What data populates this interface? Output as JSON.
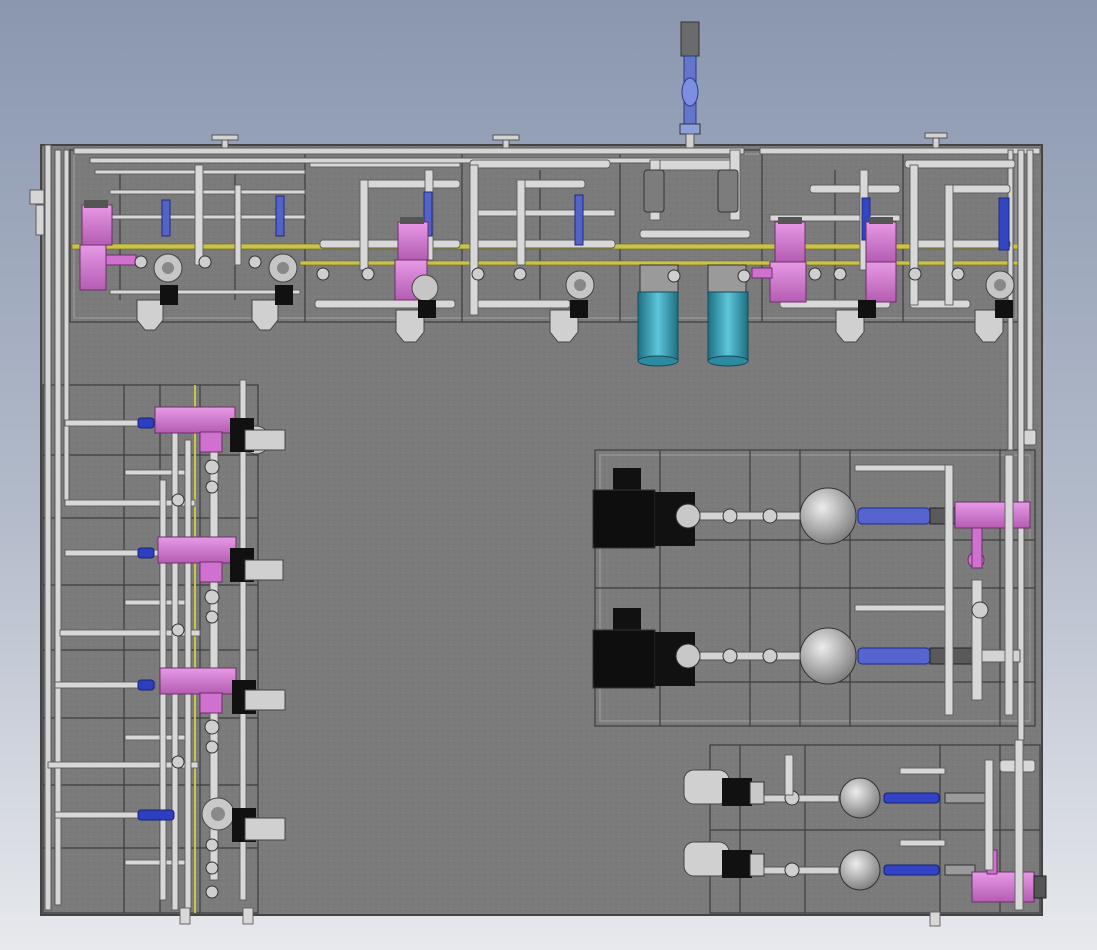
{
  "view": {
    "background_top": "#8d9ab2",
    "background_bottom": "#e6e8ec",
    "base_plate": "#7d7d7d",
    "base_plate_dark": "#6c6c6c",
    "frame": "#a9a9a9",
    "frame_edge": "#4a4a4a",
    "pipe": "#d4d4d4",
    "pipe_edge": "#5c5c5c",
    "pump_body": "#b8b8b8",
    "magenta": "#d877d6",
    "magenta_dark": "#8e3f8c",
    "blue_flow": "#5f6fd0",
    "blue_dark": "#2233a6",
    "motor_black": "#151515",
    "motor_teal": "#4fb6cc",
    "motor_teal_dark": "#1d6d80",
    "yellow_rail": "#c7c24a"
  },
  "components": {
    "top_vent": "vent-pipe",
    "upper_row": [
      "magenta-dosing-pump",
      "magenta-dosing-pump",
      "magenta-dosing-pump",
      "magenta-dosing-pump",
      "magenta-dosing-pump"
    ],
    "upper_flowmeters": [
      "flowmeter",
      "flowmeter",
      "flowmeter",
      "flowmeter",
      "flowmeter",
      "flowmeter"
    ],
    "centrifugal_motors": [
      "teal-motor",
      "teal-motor"
    ],
    "left_column": [
      "magenta-dosing-pump",
      "magenta-dosing-pump",
      "magenta-dosing-pump",
      "grey-pump"
    ],
    "diaphragm_pumps": [
      "black-diaphragm-pump",
      "black-diaphragm-pump"
    ],
    "small_pumps": [
      "black-pump",
      "black-pump"
    ]
  }
}
